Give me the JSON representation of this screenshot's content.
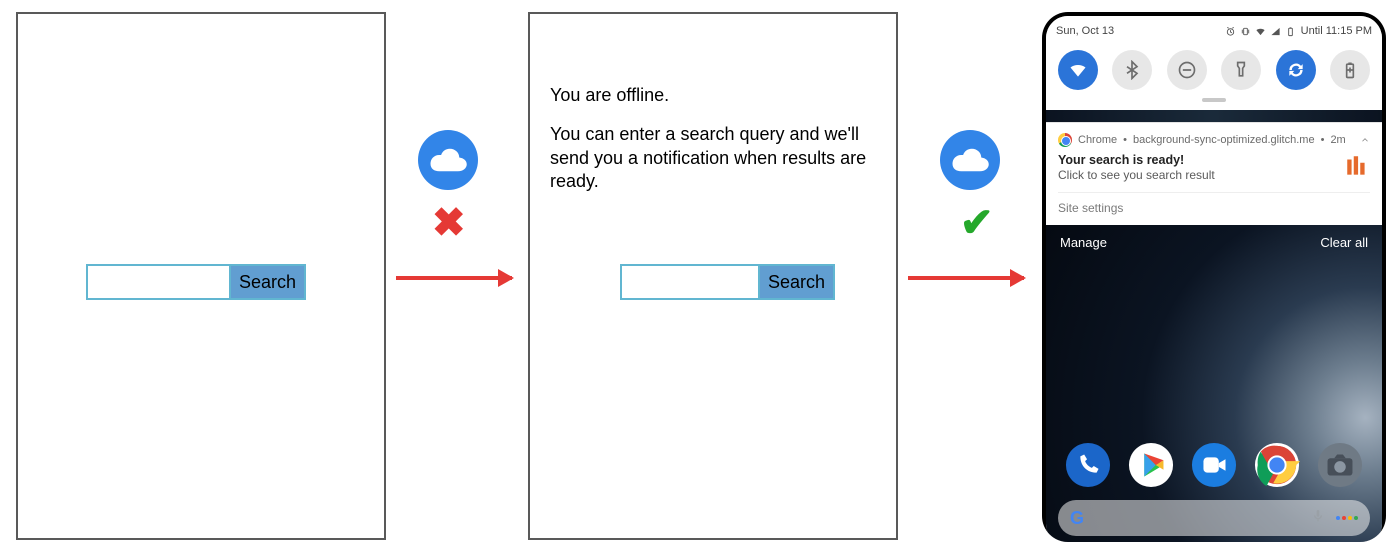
{
  "panel1": {
    "search_button": "Search",
    "input_value": ""
  },
  "panel2": {
    "offline_heading": "You are offline.",
    "offline_body": "You can enter a search query and we'll send you a notification when results are ready.",
    "search_button": "Search",
    "input_value": ""
  },
  "transition1": {
    "online": false
  },
  "transition2": {
    "online": true
  },
  "phone": {
    "statusbar": {
      "date": "Sun, Oct 13",
      "until_label": "Until 11:15 PM"
    },
    "quick_settings": [
      {
        "name": "wifi",
        "active": true
      },
      {
        "name": "bluetooth",
        "active": false
      },
      {
        "name": "dnd",
        "active": false
      },
      {
        "name": "flashlight",
        "active": false
      },
      {
        "name": "autorotate",
        "active": true
      },
      {
        "name": "battery-saver",
        "active": false
      }
    ],
    "notification": {
      "app": "Chrome",
      "source": "background-sync-optimized.glitch.me",
      "age": "2m",
      "title": "Your search is ready!",
      "body": "Click to see you search result",
      "site_settings": "Site settings"
    },
    "actions": {
      "manage": "Manage",
      "clear_all": "Clear all"
    },
    "dock": [
      "phone",
      "play",
      "duo",
      "chrome",
      "camera"
    ],
    "google_bar": {
      "g_letter": "G"
    }
  }
}
